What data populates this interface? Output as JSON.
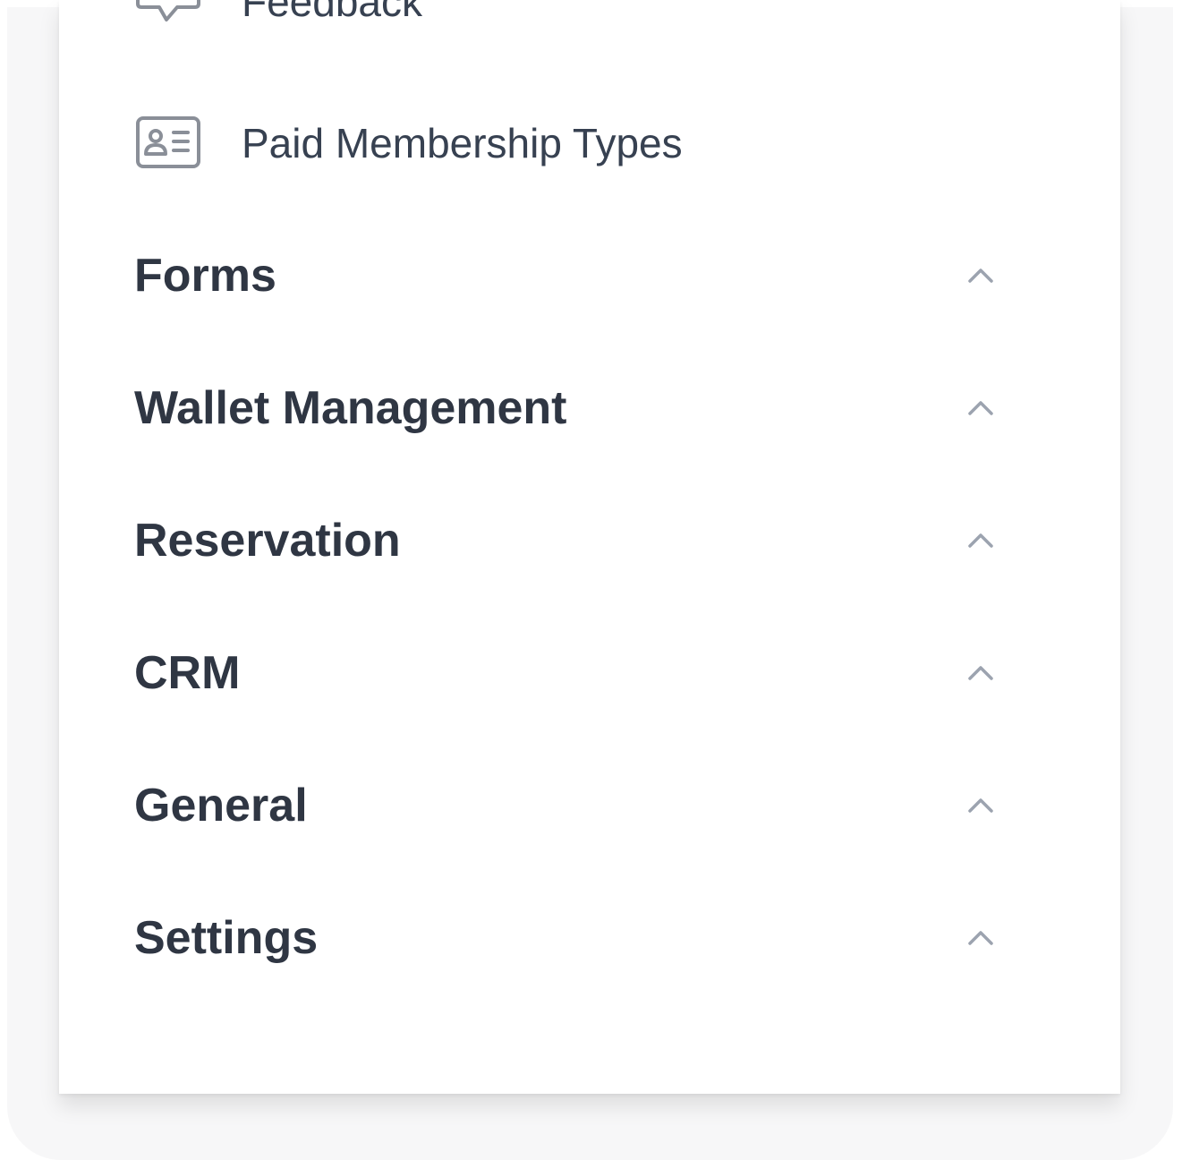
{
  "sidebar": {
    "items": [
      {
        "label": "Feedback",
        "icon": "chat-bubble-icon"
      },
      {
        "label": "Paid Membership Types",
        "icon": "id-card-icon"
      }
    ],
    "sections": [
      {
        "title": "Forms",
        "icon": "chevron-up-icon"
      },
      {
        "title": "Wallet Management",
        "icon": "chevron-up-icon"
      },
      {
        "title": "Reservation",
        "icon": "chevron-up-icon"
      },
      {
        "title": "CRM",
        "icon": "chevron-up-icon"
      },
      {
        "title": "General",
        "icon": "chevron-up-icon"
      },
      {
        "title": "Settings",
        "icon": "chevron-up-icon"
      }
    ]
  },
  "colors": {
    "text": "#374151",
    "heading": "#2f3643",
    "icon": "#8a8f98",
    "chevron": "#9ca3af",
    "panel": "#ffffff",
    "backdrop": "#f7f7f8"
  }
}
